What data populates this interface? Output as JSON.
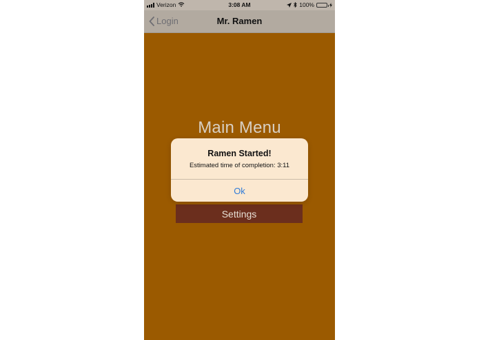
{
  "status_bar": {
    "carrier": "Verizon",
    "time": "3:08 AM",
    "battery": "100%",
    "battery_level": 1.0
  },
  "nav": {
    "back_label": "Login",
    "title": "Mr. Ramen"
  },
  "main": {
    "title": "Main Menu",
    "settings_label": "Settings"
  },
  "alert": {
    "title": "Ramen Started!",
    "message": "Estimated time of completion: 3:11",
    "ok_label": "Ok"
  },
  "colors": {
    "background": "#9b5a00",
    "nav_bar": "#b2aaa0",
    "button": "#6b2e1d",
    "alert": "#fbe8d0",
    "link": "#2f7bd8"
  }
}
